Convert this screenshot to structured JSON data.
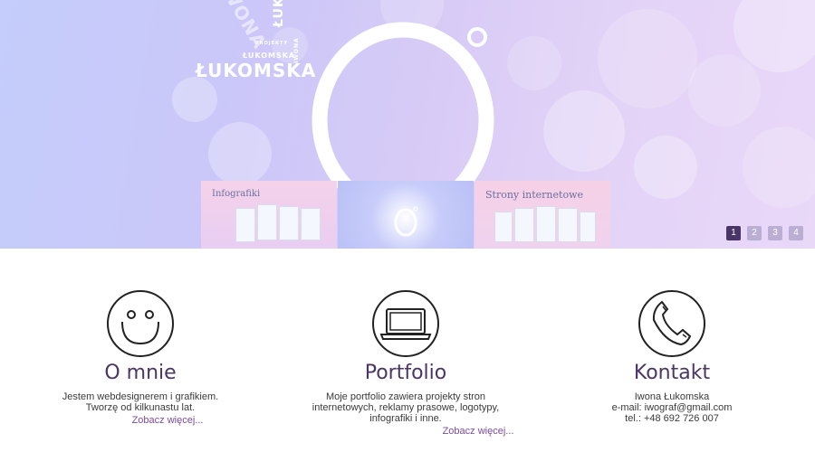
{
  "hero": {
    "logo_words": [
      "IWONA",
      "ŁUKOMSKA",
      "ŁUKOMSKA",
      "ŁUKOMSKA",
      "IWONA",
      "PROJEKTY"
    ],
    "slides": [
      {
        "title": "Infografiki"
      },
      {
        "title": ""
      },
      {
        "title": "Strony internetowe"
      }
    ],
    "pager": [
      "1",
      "2",
      "3",
      "4"
    ],
    "active_page": 1
  },
  "features": [
    {
      "icon": "smiley-icon",
      "title": "O mnie",
      "text_lines": [
        "Jestem webdesignerem i grafikiem.",
        "Tworzę od kilkunastu lat."
      ],
      "link": "Zobacz więcej..."
    },
    {
      "icon": "laptop-icon",
      "title": "Portfolio",
      "text_lines": [
        "Moje portfolio zawiera projekty stron",
        "internetowych, reklamy prasowe, logotypy,",
        "infografiki i inne."
      ],
      "link": "Zobacz więcej..."
    },
    {
      "icon": "phone-icon",
      "title": "Kontakt",
      "text_lines": [
        "Iwona Łukomska",
        "e-mail: iwograf@gmail.com",
        "tel.: +48 692 726 007"
      ]
    }
  ],
  "colors": {
    "accent": "#4a3566",
    "link": "#7b4a9c"
  }
}
